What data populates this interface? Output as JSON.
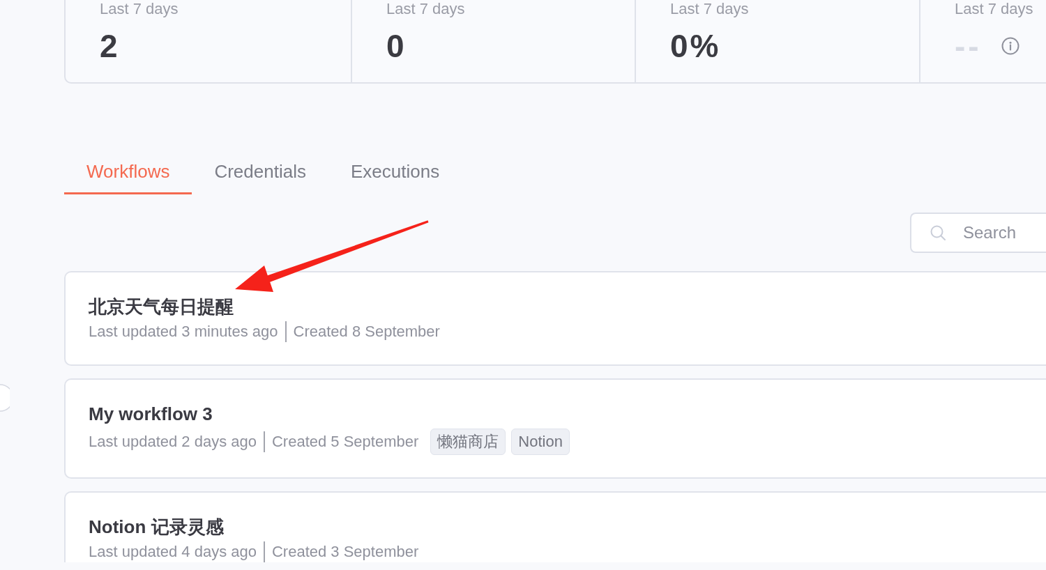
{
  "stats": [
    {
      "kind": "number",
      "label": "Last 7 days",
      "value": "2"
    },
    {
      "kind": "number",
      "label": "Last 7 days",
      "value": "0"
    },
    {
      "kind": "number",
      "label": "Last 7 days",
      "value": "0%"
    },
    {
      "kind": "empty",
      "label": "Last 7 days",
      "value": "--"
    }
  ],
  "tabs": [
    {
      "label": "Workflows",
      "selected": true
    },
    {
      "label": "Credentials",
      "selected": false
    },
    {
      "label": "Executions",
      "selected": false
    }
  ],
  "search": {
    "placeholder": "Search"
  },
  "workflows": [
    {
      "name": "北京天气每日提醒",
      "updated": "Last updated 3 minutes ago",
      "created": "Created 8 September"
    },
    {
      "name": "My workflow 3",
      "updated": "Last updated 2 days ago",
      "created": "Created 5 September",
      "tags": [
        "懒猫商店",
        "Notion"
      ]
    },
    {
      "name": "Notion 记录灵感",
      "updated": "Last updated 4 days ago",
      "created": "Created 3 September"
    }
  ]
}
